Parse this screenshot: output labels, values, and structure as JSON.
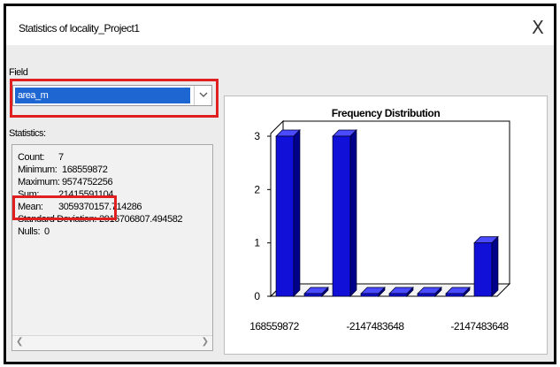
{
  "window": {
    "title": "Statistics of locality_Project1",
    "close_glyph": "X"
  },
  "field": {
    "label": "Field",
    "selected": "area_m"
  },
  "statistics": {
    "label": "Statistics:",
    "rows": [
      {
        "label": "Count:",
        "value": "7"
      },
      {
        "label": "Minimum:",
        "value": "168559872"
      },
      {
        "label": "Maximum:",
        "value": "9574752256"
      },
      {
        "label": "Sum:",
        "value": "21415591104"
      },
      {
        "label": "Mean:",
        "value": "3059370157.714286"
      },
      {
        "label": "Standard Deviation:",
        "value": "2916706807.494582"
      },
      {
        "label": "Nulls:",
        "value": "0"
      }
    ]
  },
  "chart_data": {
    "type": "bar",
    "title": "Frequency Distribution",
    "values": [
      3,
      0,
      3,
      0,
      0,
      0,
      0,
      1
    ],
    "yticks": [
      0,
      1,
      2,
      3
    ],
    "ylim": [
      0,
      3
    ],
    "xticklabels": [
      "168559872",
      "-2147483648",
      "-2147483648"
    ],
    "bar_color": "#1010d8"
  },
  "colors": {
    "highlight": "#e02020",
    "selection": "#1e67d2"
  }
}
